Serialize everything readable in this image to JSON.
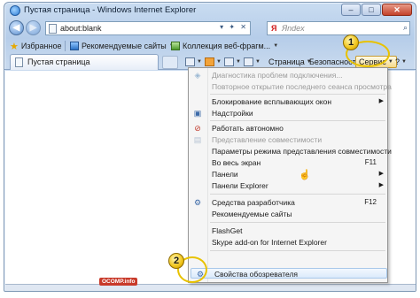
{
  "window": {
    "title": "Пустая страница - Windows Internet Explorer",
    "buttons": {
      "minimize": "–",
      "maximize": "□",
      "close": "✕"
    }
  },
  "address": {
    "url": "about:blank",
    "refresh_stop": "▾ ✦ ✕"
  },
  "search": {
    "provider": "Я",
    "placeholder": "Яndex",
    "button": "⌕"
  },
  "favorites": {
    "favorites_label": "Избранное",
    "suggested_sites": "Рекомендуемые сайты",
    "web_slices": "Коллекция веб-фрагм..."
  },
  "tab": {
    "title": "Пустая страница"
  },
  "commandbar": {
    "page": "Страница",
    "safety": "Безопасность",
    "tools": "Сервис",
    "help": "?"
  },
  "menu": {
    "items": [
      {
        "label": "Диагностика проблем подключения...",
        "disabled": true
      },
      {
        "label": "Повторное открытие последнего сеанса просмотра",
        "disabled": true
      },
      {
        "label": "Блокирование всплывающих окон",
        "submenu": true
      },
      {
        "label": "Надстройки"
      },
      {
        "label": "Работать автономно"
      },
      {
        "label": "Представление совместимости",
        "disabled": true
      },
      {
        "label": "Параметры режима представления совместимости"
      },
      {
        "label": "Во весь экран",
        "shortcut": "F11"
      },
      {
        "label": "Панели",
        "submenu": true
      },
      {
        "label": "Панели Explorer",
        "submenu": true
      },
      {
        "label": "Средства разработчика",
        "shortcut": "F12"
      },
      {
        "label": "Рекомендуемые сайты"
      },
      {
        "label": "FlashGet"
      },
      {
        "label": "Skype add-on for Internet Explorer"
      },
      {
        "label": "Свойства обозревателя",
        "highlighted": true
      }
    ]
  },
  "annotations": {
    "badge_1": "1",
    "badge_2": "2"
  },
  "watermark": "OCOMP.info",
  "colors": {
    "accent_yellow": "#f0c419",
    "menu_bg": "#f5f5f5",
    "frame": "#c9dcf1"
  }
}
